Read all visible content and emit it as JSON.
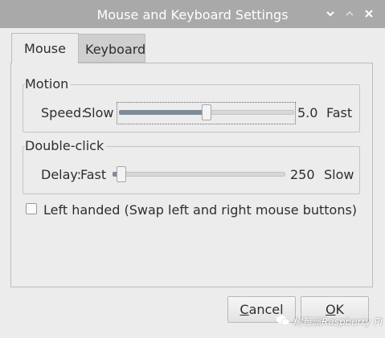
{
  "window": {
    "title": "Mouse and Keyboard Settings"
  },
  "tabs": [
    {
      "label": "Mouse",
      "active": true
    },
    {
      "label": "Keyboard",
      "active": false
    }
  ],
  "motion": {
    "legend": "Motion",
    "label": "Speed:",
    "min_label": "Slow",
    "max_label": "Fast",
    "value": "5.0",
    "level_fraction": 0.5
  },
  "double_click": {
    "legend": "Double-click",
    "label": "Delay:",
    "min_label": "Fast",
    "max_label": "Slow",
    "value": "250",
    "level_fraction": 0.05
  },
  "left_handed": {
    "label": "Left handed (Swap left and right mouse buttons)",
    "checked": false
  },
  "buttons": {
    "cancel_first": "C",
    "cancel_rest": "ancel",
    "ok_first": "O",
    "ok_rest": "K"
  },
  "watermark": {
    "text": "树莓派Raspberry Pi",
    "icon": "wechat-icon"
  },
  "colors": {
    "titlebar": "#a9a9a9",
    "slider_fill": "#7f8b98",
    "background": "#ececec"
  }
}
